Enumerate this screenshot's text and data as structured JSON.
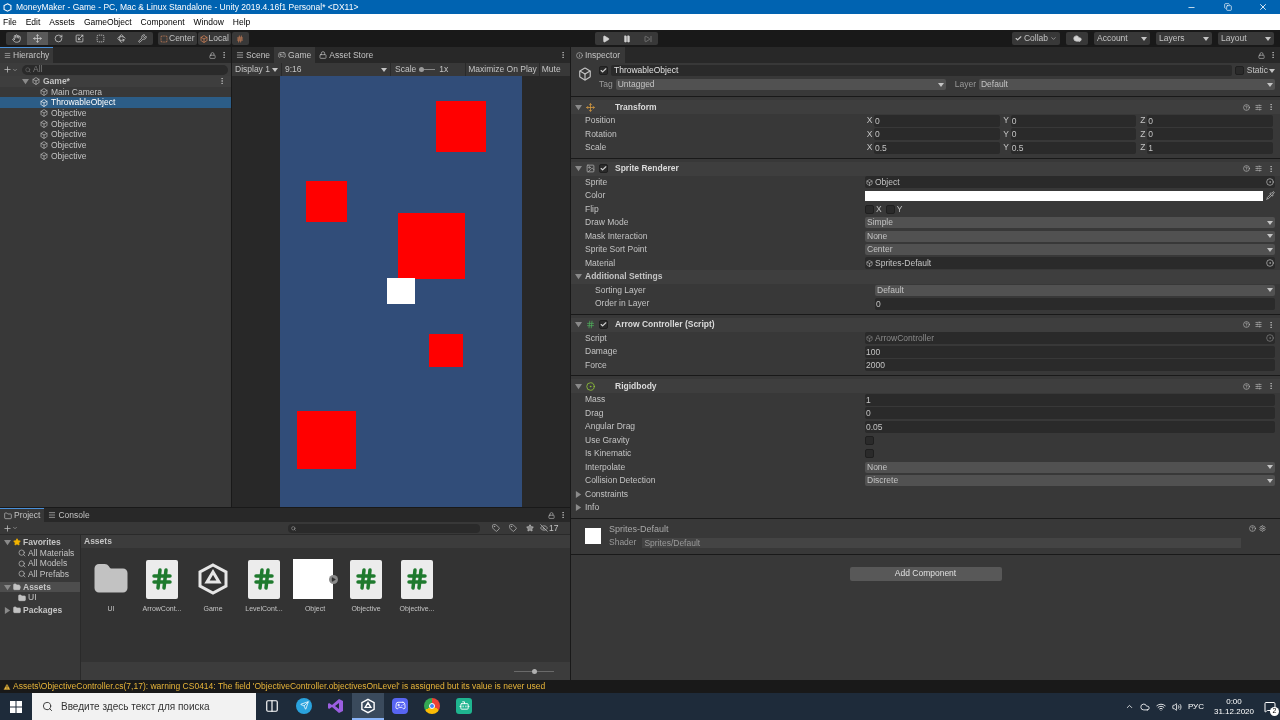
{
  "window": {
    "title": "MoneyMaker - Game - PC, Mac & Linux Standalone - Unity 2019.4.16f1 Personal* <DX11>"
  },
  "menu": [
    "File",
    "Edit",
    "Assets",
    "GameObject",
    "Component",
    "Window",
    "Help"
  ],
  "toolbar": {
    "tools": [
      {
        "kind": "hand",
        "selected": false
      },
      {
        "kind": "move",
        "selected": true
      },
      {
        "kind": "rotate",
        "selected": false
      },
      {
        "kind": "scale",
        "selected": false
      },
      {
        "kind": "rect",
        "selected": false
      },
      {
        "kind": "transform",
        "selected": false
      },
      {
        "kind": "custom",
        "selected": false
      }
    ],
    "pivot": "Center",
    "space": "Local",
    "collab": "Collab",
    "account": "Account",
    "layers": "Layers",
    "layout": "Layout"
  },
  "hierarchy": {
    "tab": "Hierarchy",
    "search_placeholder": "All",
    "scene": "Game*",
    "items": [
      {
        "name": "Main Camera",
        "selected": false
      },
      {
        "name": "ThrowableObject",
        "selected": true
      },
      {
        "name": "Objective",
        "selected": false
      },
      {
        "name": "Objective",
        "selected": false
      },
      {
        "name": "Objective",
        "selected": false
      },
      {
        "name": "Objective",
        "selected": false
      },
      {
        "name": "Objective",
        "selected": false
      }
    ]
  },
  "game_view": {
    "tabs": [
      {
        "label": "Scene",
        "kind": "scene",
        "selected": false
      },
      {
        "label": "Game",
        "kind": "game",
        "selected": true
      },
      {
        "label": "Asset Store",
        "kind": "store",
        "selected": false
      }
    ],
    "display": "Display 1",
    "aspect": "9:16",
    "scale_label": "Scale",
    "scale_value": "1x",
    "maximize": "Maximize On Play",
    "mute": "Mute"
  },
  "inspector": {
    "tab": "Inspector",
    "name": "ThrowableObject",
    "active": true,
    "static_label": "Static",
    "static": false,
    "tag_label": "Tag",
    "tag": "Untagged",
    "layer_label": "Layer",
    "layer": "Default",
    "components": [
      {
        "title": "Transform",
        "kind": "transform",
        "rows": [
          {
            "kind": "vector",
            "label": "Position",
            "axes": [
              {
                "axis": "X",
                "value": "0"
              },
              {
                "axis": "Y",
                "value": "0"
              },
              {
                "axis": "Z",
                "value": "0"
              }
            ]
          },
          {
            "kind": "vector",
            "label": "Rotation",
            "axes": [
              {
                "axis": "X",
                "value": "0"
              },
              {
                "axis": "Y",
                "value": "0"
              },
              {
                "axis": "Z",
                "value": "0"
              }
            ]
          },
          {
            "kind": "vector",
            "label": "Scale",
            "axes": [
              {
                "axis": "X",
                "value": "0.5"
              },
              {
                "axis": "Y",
                "value": "0.5"
              },
              {
                "axis": "Z",
                "value": "1"
              }
            ]
          }
        ]
      },
      {
        "title": "Sprite Renderer",
        "kind": "sprite",
        "enabled": true,
        "rows": [
          {
            "kind": "object",
            "label": "Sprite",
            "value": "Object",
            "disabled": false
          },
          {
            "kind": "color",
            "label": "Color",
            "color": "#ffffff"
          },
          {
            "kind": "flip",
            "label": "Flip",
            "options": [
              {
                "label": "X",
                "checked": false
              },
              {
                "label": "Y",
                "checked": false
              }
            ]
          },
          {
            "kind": "dropdown",
            "label": "Draw Mode",
            "value": "Simple"
          },
          {
            "kind": "dropdown",
            "label": "Mask Interaction",
            "value": "None"
          },
          {
            "kind": "dropdown",
            "label": "Sprite Sort Point",
            "value": "Center"
          },
          {
            "kind": "object",
            "label": "Material",
            "value": "Sprites-Default",
            "disabled": false
          },
          {
            "kind": "section",
            "label": "Additional Settings",
            "expanded": true,
            "children": [
              {
                "kind": "dropdown",
                "label": "Sorting Layer",
                "value": "Default"
              },
              {
                "kind": "field",
                "label": "Order in Layer",
                "value": "0"
              }
            ]
          }
        ]
      },
      {
        "title": "Arrow Controller (Script)",
        "kind": "script",
        "enabled": true,
        "rows": [
          {
            "kind": "object",
            "label": "Script",
            "value": "ArrowController",
            "disabled": true
          },
          {
            "kind": "field",
            "label": "Damage",
            "value": "100"
          },
          {
            "kind": "field",
            "label": "Force",
            "value": "2000"
          }
        ]
      },
      {
        "title": "Rigidbody",
        "kind": "rigidbody",
        "rows": [
          {
            "kind": "field",
            "label": "Mass",
            "value": "1"
          },
          {
            "kind": "field",
            "label": "Drag",
            "value": "0"
          },
          {
            "kind": "field",
            "label": "Angular Drag",
            "value": "0.05"
          },
          {
            "kind": "checkbox",
            "label": "Use Gravity",
            "checked": false
          },
          {
            "kind": "checkbox",
            "label": "Is Kinematic",
            "checked": false
          },
          {
            "kind": "dropdown",
            "label": "Interpolate",
            "value": "None"
          },
          {
            "kind": "dropdown",
            "label": "Collision Detection",
            "value": "Discrete"
          },
          {
            "kind": "foldout",
            "label": "Constraints",
            "expanded": false
          },
          {
            "kind": "foldout",
            "label": "Info",
            "expanded": false
          }
        ]
      }
    ],
    "material": {
      "name": "Sprites-Default",
      "shader_label": "Shader",
      "shader": "Sprites/Default"
    },
    "add_component": "Add Component"
  },
  "project": {
    "tabs": [
      {
        "label": "Project",
        "kind": "project",
        "selected": true
      },
      {
        "label": "Console",
        "kind": "console",
        "selected": false
      }
    ],
    "hidden_count": "17",
    "tree": [
      {
        "label": "Favorites",
        "kind": "favorites",
        "expanded": true,
        "selected": false,
        "children": [
          {
            "label": "All Materials",
            "kind": "search",
            "selected": false
          },
          {
            "label": "All Models",
            "kind": "search",
            "selected": false
          },
          {
            "label": "All Prefabs",
            "kind": "search",
            "selected": false
          }
        ]
      },
      {
        "label": "Assets",
        "kind": "folder",
        "expanded": true,
        "selected": true,
        "children": [
          {
            "label": "UI",
            "kind": "folder",
            "selected": false
          }
        ]
      },
      {
        "label": "Packages",
        "kind": "folder",
        "expanded": false,
        "selected": false
      }
    ],
    "breadcrumb": "Assets",
    "assets": [
      {
        "name": "UI",
        "kind": "folder"
      },
      {
        "name": "ArrowCont...",
        "kind": "script"
      },
      {
        "name": "Game",
        "kind": "scene"
      },
      {
        "name": "LevelCont...",
        "kind": "script"
      },
      {
        "name": "Object",
        "kind": "sprite"
      },
      {
        "name": "Objective",
        "kind": "script"
      },
      {
        "name": "Objective...",
        "kind": "script"
      }
    ],
    "zoom": {
      "level": 0.5
    }
  },
  "status_bar": {
    "message": "Assets\\ObjectiveController.cs(7,17): warning CS0414: The field 'ObjectiveController.objectivesOnLevel' is assigned but its value is never used"
  },
  "taskbar": {
    "search_placeholder": "Введите здесь текст для поиска",
    "apps": [
      {
        "kind": "taskview",
        "selected": false
      },
      {
        "kind": "telegram",
        "selected": false
      },
      {
        "kind": "vs",
        "selected": false
      },
      {
        "kind": "unity",
        "selected": true
      },
      {
        "kind": "discord",
        "selected": false
      },
      {
        "kind": "chrome",
        "selected": false
      },
      {
        "kind": "robot",
        "selected": false
      }
    ],
    "language": "РУС",
    "time": "0:00",
    "date": "31.12.2020",
    "notifications": "2"
  }
}
